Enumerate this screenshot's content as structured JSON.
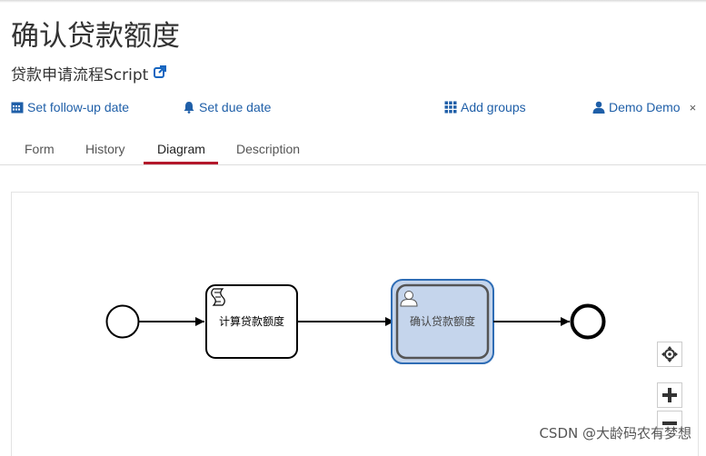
{
  "task": {
    "title": "确认贷款额度",
    "process_name": "贷款申请流程Script"
  },
  "actions": {
    "follow_up": "Set follow-up date",
    "due_date": "Set due date",
    "groups": "Add groups",
    "assignee": "Demo Demo",
    "remove_assignee": "×"
  },
  "tabs": [
    "Form",
    "History",
    "Diagram",
    "Description"
  ],
  "active_tab": "Diagram",
  "diagram": {
    "script_task_label": "计算贷款额度",
    "user_task_label": "确认贷款额度",
    "highlight_color": "#c5d5ec",
    "highlight_border": "#2f6db5"
  },
  "colors": {
    "link": "#1f5fa8",
    "active_tab": "#b3182b"
  },
  "watermark": "CSDN @大龄码农有梦想"
}
